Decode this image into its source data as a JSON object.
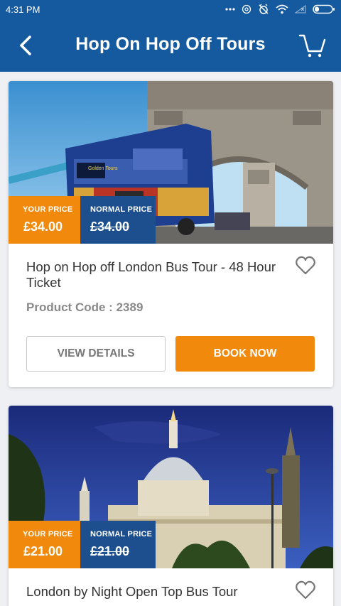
{
  "status_bar": {
    "time": "4:31 PM",
    "icons": [
      "more-dots-icon",
      "data-saver-icon",
      "alarm-off-icon",
      "wifi-icon",
      "signal-icon",
      "battery-icon"
    ]
  },
  "header": {
    "title": "Hop On Hop Off Tours",
    "back_icon": "chevron-left-icon",
    "cart_icon": "cart-icon",
    "color": "#155a9e"
  },
  "colors": {
    "orange": "#f0890c",
    "navy": "#1d4f8f"
  },
  "products": [
    {
      "title": "Hop on Hop off London Bus Tour - 48 Hour Ticket",
      "your_price_label": "YOUR PRICE",
      "your_price": "£34.00",
      "normal_price_label": "NORMAL PRICE",
      "normal_price": "£34.00",
      "product_code_label": "Product Code :",
      "product_code": "2389",
      "view_details_label": "VIEW DETAILS",
      "book_now_label": "BOOK NOW",
      "image": "tower-bridge-bus-photo",
      "bus_sign_text": "Golden Tours"
    },
    {
      "title": "London by Night Open Top Bus Tour",
      "your_price_label": "YOUR PRICE",
      "your_price": "£21.00",
      "normal_price_label": "NORMAL PRICE",
      "normal_price": "£21.00",
      "image": "st-pauls-night-photo"
    }
  ]
}
